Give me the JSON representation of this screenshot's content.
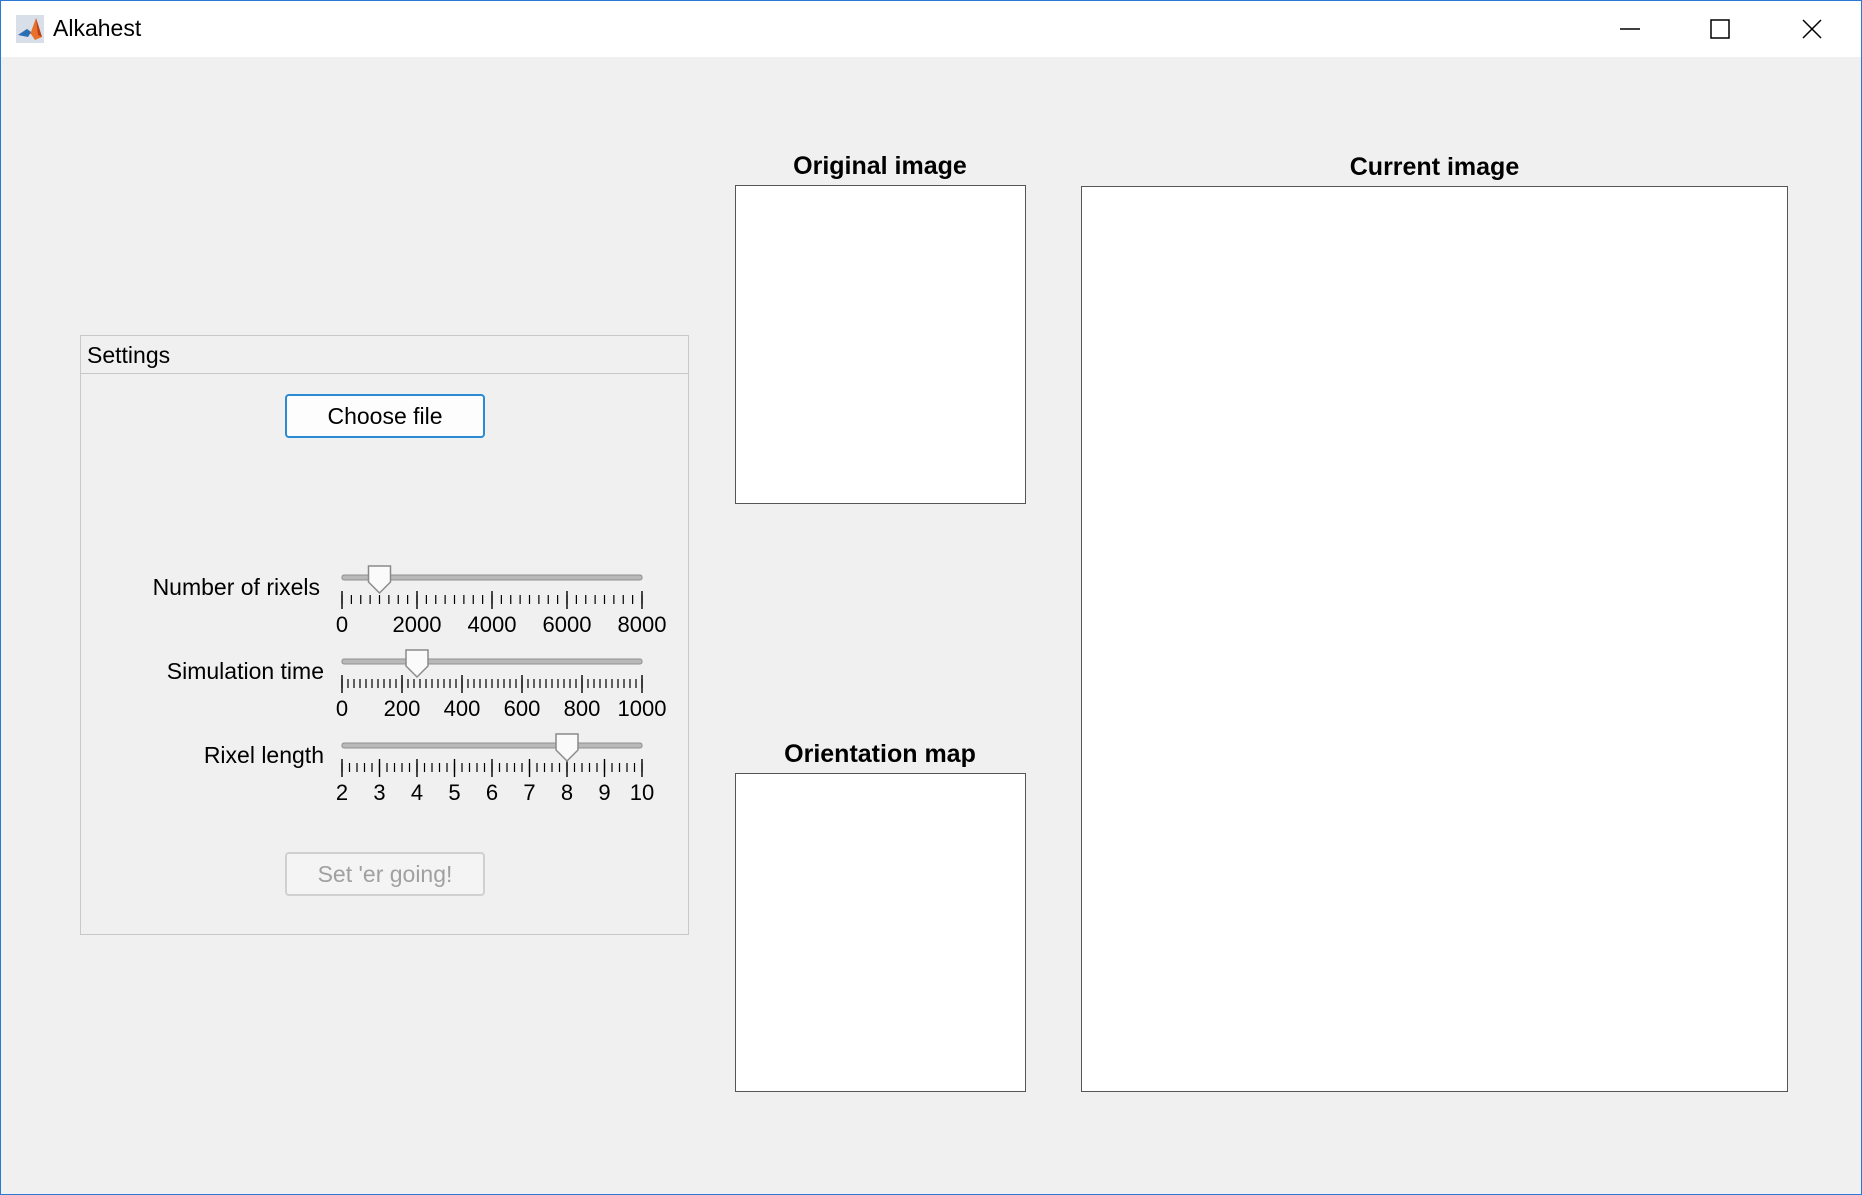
{
  "window": {
    "title": "Alkahest",
    "icon": "matlab-logo-icon",
    "controls": [
      "minimize-icon",
      "maximize-icon",
      "close-icon"
    ]
  },
  "settings": {
    "title": "Settings",
    "choose_file_label": "Choose file",
    "run_label": "Set 'er going!",
    "sliders": [
      {
        "label": "Number of rixels",
        "min": 0,
        "max": 8000,
        "value": 1000,
        "tick_labels": [
          "0",
          "2000",
          "4000",
          "6000",
          "8000"
        ],
        "minor_ticks": 33
      },
      {
        "label": "Simulation time",
        "min": 0,
        "max": 1000,
        "value": 250,
        "tick_labels": [
          "0",
          "200",
          "400",
          "600",
          "800",
          "1000"
        ],
        "minor_ticks": 51
      },
      {
        "label": "Rixel length",
        "min": 2,
        "max": 10,
        "value": 8,
        "tick_labels": [
          "2",
          "3",
          "4",
          "5",
          "6",
          "7",
          "8",
          "9",
          "10"
        ],
        "minor_ticks": 41
      }
    ]
  },
  "axes": {
    "original_title": "Original image",
    "orientation_title": "Orientation map",
    "current_title": "Current image"
  },
  "colors": {
    "window_bg": "#f0f0f0",
    "accent": "#2a8ad4",
    "disabled_text": "#a0a0a0"
  }
}
